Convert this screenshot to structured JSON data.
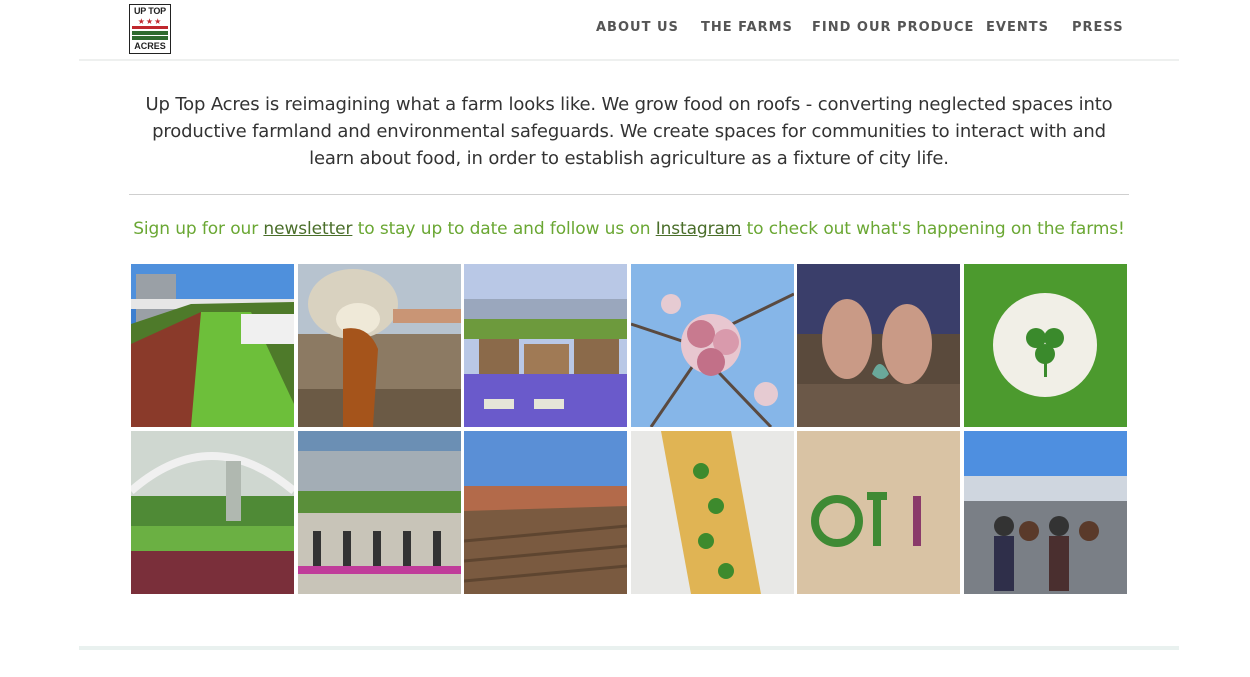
{
  "logo": {
    "line1": "UP TOP",
    "stars": "★★★",
    "line2": "ACRES"
  },
  "nav": {
    "items": [
      {
        "label": "ABOUT US"
      },
      {
        "label": "THE FARMS"
      },
      {
        "label": "FIND OUR PRODUCE"
      },
      {
        "label": "EVENTS"
      },
      {
        "label": "PRESS"
      }
    ]
  },
  "intro": {
    "text": "Up Top Acres is reimagining what a farm looks like. We grow food on roofs - converting neglected spaces into productive farmland and environmental safeguards.  We create spaces for communities to interact with and learn about food, in order to establish agriculture as a fixture of city life."
  },
  "signup": {
    "before": "Sign up for our ",
    "newsletter_link": "newsletter",
    "middle": " to stay up to date and follow us on ",
    "instagram_link": "Instagram",
    "after": " to check out what's happening on the farms!"
  },
  "gallery": {
    "images": [
      {
        "subject": "rooftop vegetable beds"
      },
      {
        "subject": "honey pouring from extractor"
      },
      {
        "subject": "wooden letters display on table"
      },
      {
        "subject": "pink blossoms against blue sky"
      },
      {
        "subject": "hands planting seedling"
      },
      {
        "subject": "microgreens surrounding shamrock"
      },
      {
        "subject": "greenhouse with greens"
      },
      {
        "subject": "rooftop yoga by stadium"
      },
      {
        "subject": "tilled rooftop field"
      },
      {
        "subject": "tart with greens"
      },
      {
        "subject": "microgreens spelling letters"
      },
      {
        "subject": "rooftop event crowd"
      }
    ]
  },
  "colors": {
    "signup_green": "#6aa733",
    "link_green": "#4a6e2a",
    "logo_red": "#c0272d",
    "logo_green": "#2f6b2f"
  }
}
